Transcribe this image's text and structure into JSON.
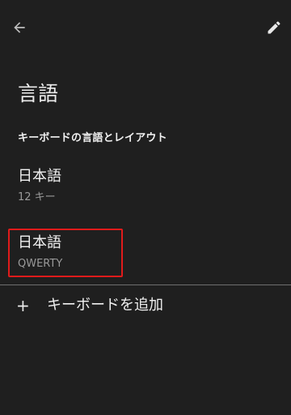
{
  "header": {
    "back_icon": "arrow-left-icon",
    "edit_icon": "pencil-icon"
  },
  "page": {
    "title": "言語"
  },
  "section": {
    "header": "キーボードの言語とレイアウト"
  },
  "keyboards": [
    {
      "name": "日本語",
      "layout": "12 キー"
    },
    {
      "name": "日本語",
      "layout": "QWERTY"
    }
  ],
  "add_keyboard": {
    "icon": "+",
    "label": "キーボードを追加"
  },
  "colors": {
    "background": "#1f1f1f",
    "highlight": "#e01b1b"
  }
}
